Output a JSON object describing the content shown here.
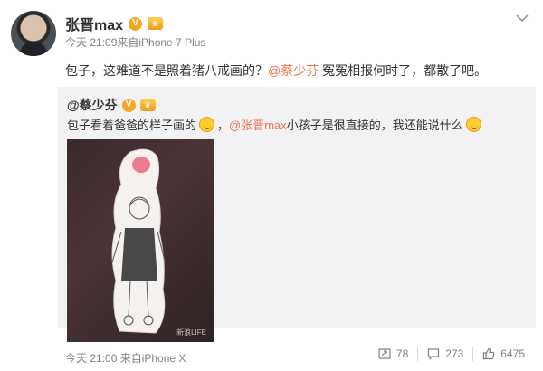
{
  "post": {
    "author_name": "张晋max",
    "meta": "今天 21:09来自iPhone 7 Plus",
    "text_before": "包子，这难道不是照着猪八戒画的？",
    "mention": "@蔡少芬",
    "text_after": " 冤冤相报何时了，都散了吧。"
  },
  "repost": {
    "author": "@蔡少芬",
    "text_before": "包子看着爸爸的样子画的",
    "text_middle": "，",
    "mention": "@张晋max",
    "text_after": " 小孩子是很直接的，我还能说什么",
    "image_watermark": "新浪LIFE",
    "footer_meta": "今天 21:00 来自iPhone X"
  },
  "actions": {
    "repost_count": "78",
    "comment_count": "273",
    "like_count": "6475"
  },
  "colors": {
    "mention": "#eb7350",
    "verified_badge": "#f5a623",
    "repost_background": "#f2f2f5"
  },
  "icons": [
    "avatar",
    "verified-badge-icon",
    "vip-crown-icon",
    "chevron-down-icon",
    "laughing-emoji-icon",
    "smirk-emoji-icon",
    "repost-icon",
    "comment-icon",
    "like-icon"
  ]
}
